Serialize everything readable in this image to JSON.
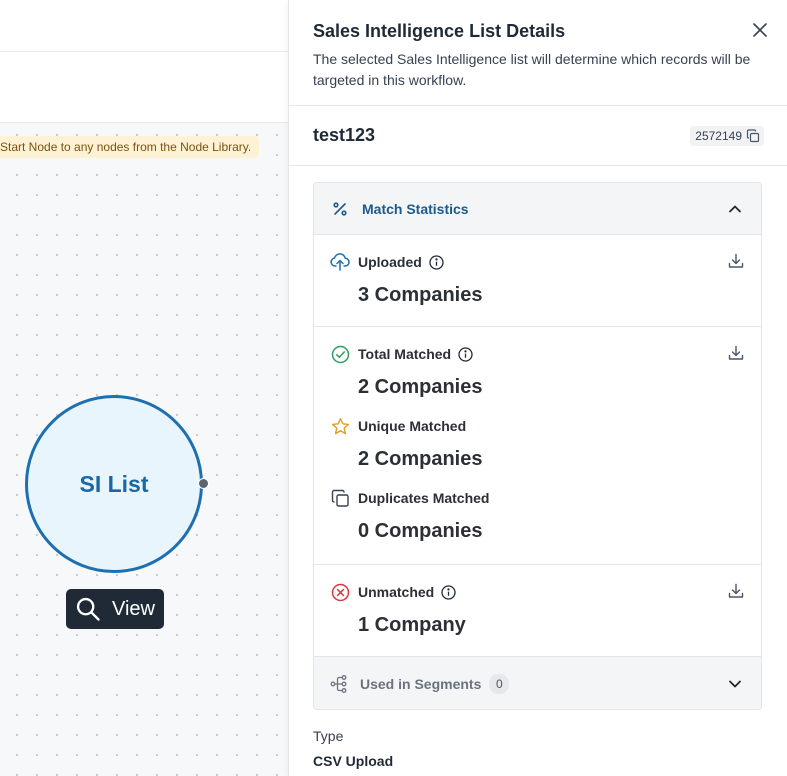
{
  "canvas": {
    "hint_text": "Start Node to any nodes from the Node Library.",
    "node_label": "SI List",
    "view_button_label": "View"
  },
  "drawer": {
    "title": "Sales Intelligence List Details",
    "description": "The selected Sales Intelligence list will determine which records will be targeted in this workflow.",
    "list_name": "test123",
    "list_id": "2572149",
    "stats": {
      "header_label": "Match Statistics",
      "uploaded": {
        "label": "Uploaded",
        "value": "3 Companies"
      },
      "total_matched": {
        "label": "Total Matched",
        "value": "2 Companies"
      },
      "unique_matched": {
        "label": "Unique Matched",
        "value": "2 Companies"
      },
      "duplicates_matched": {
        "label": "Duplicates Matched",
        "value": "0 Companies"
      },
      "unmatched": {
        "label": "Unmatched",
        "value": "1 Company"
      },
      "segments": {
        "label": "Used in Segments",
        "count": "0"
      }
    },
    "type_label": "Type",
    "type_value": "CSV Upload"
  },
  "icons": {
    "close": "close-icon",
    "copy": "copy-icon",
    "percent": "percent-icon",
    "chevron_up": "chevron-up-icon",
    "chevron_down": "chevron-down-icon",
    "upload_cloud": "upload-cloud-icon",
    "check_circle": "check-circle-icon",
    "star": "star-icon",
    "duplicate": "duplicate-icon",
    "x_circle": "x-circle-icon",
    "info": "info-icon",
    "download": "download-icon",
    "segments": "segments-icon",
    "search": "search-icon"
  },
  "colors": {
    "accent_blue": "#1b5a8a",
    "node_blue": "#1e6fb0",
    "success_green": "#2e9e5b",
    "warning_amber": "#e0a126",
    "error_red": "#d9363e"
  }
}
